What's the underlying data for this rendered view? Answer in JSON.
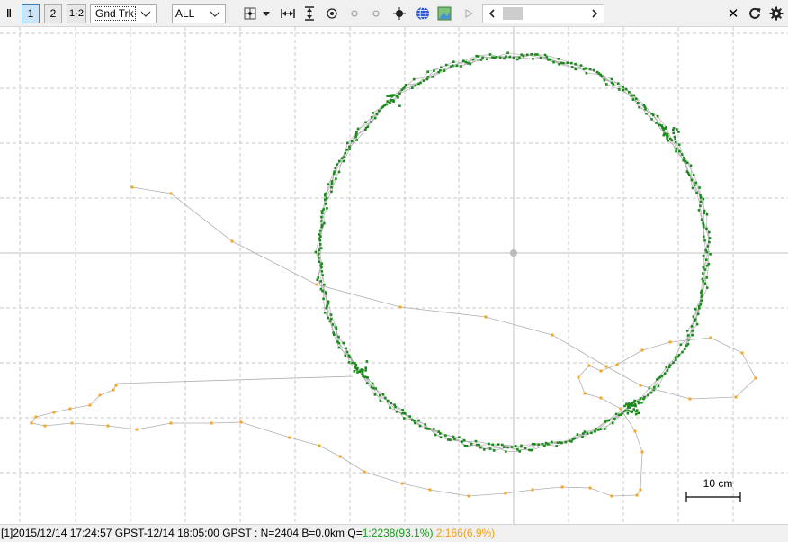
{
  "toolbar": {
    "pause_glyph": "‖",
    "plot_buttons": [
      "1",
      "2",
      "1·2"
    ],
    "plot_type": "Gnd Trk",
    "quality_filter": "ALL",
    "close_glyph": "✕"
  },
  "plot": {
    "scale_label": "10 cm",
    "colors": {
      "q1": "#1a8a1a",
      "q2": "#f5a623",
      "track": "#b0b0b0",
      "grid": "#c8c8c8"
    }
  },
  "status": {
    "main": "[1]2015/12/14 17:24:57 GPST-12/14 18:05:00 GPST : N=2404 B=0.0km Q=",
    "q1": "1:2238(93.1%)",
    "q2": "2:166(6.9%)"
  }
}
